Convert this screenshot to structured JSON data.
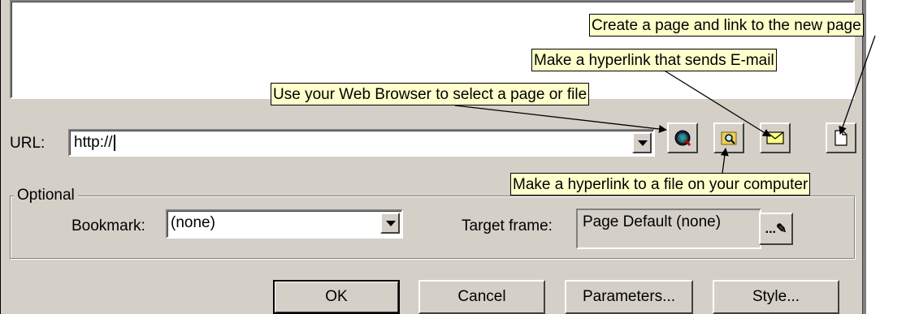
{
  "url": {
    "label": "URL:",
    "value": "http://"
  },
  "toolbar": {
    "browser_icon": "web-browser-icon",
    "file_icon": "folder-search-icon",
    "email_icon": "envelope-icon",
    "new_page_icon": "new-page-icon"
  },
  "optional": {
    "group_title": "Optional",
    "bookmark_label": "Bookmark:",
    "bookmark_value": "(none)",
    "target_label": "Target frame:",
    "target_value": "Page Default (none)",
    "target_button": "...✎"
  },
  "buttons": {
    "ok": "OK",
    "cancel": "Cancel",
    "parameters": "Parameters...",
    "style": "Style..."
  },
  "callouts": {
    "new_page": "Create a page and link to the new page",
    "email": "Make a hyperlink that sends E-mail",
    "browser": "Use your Web Browser to select a page or file",
    "file": "Make a hyperlink to a file on your computer"
  }
}
